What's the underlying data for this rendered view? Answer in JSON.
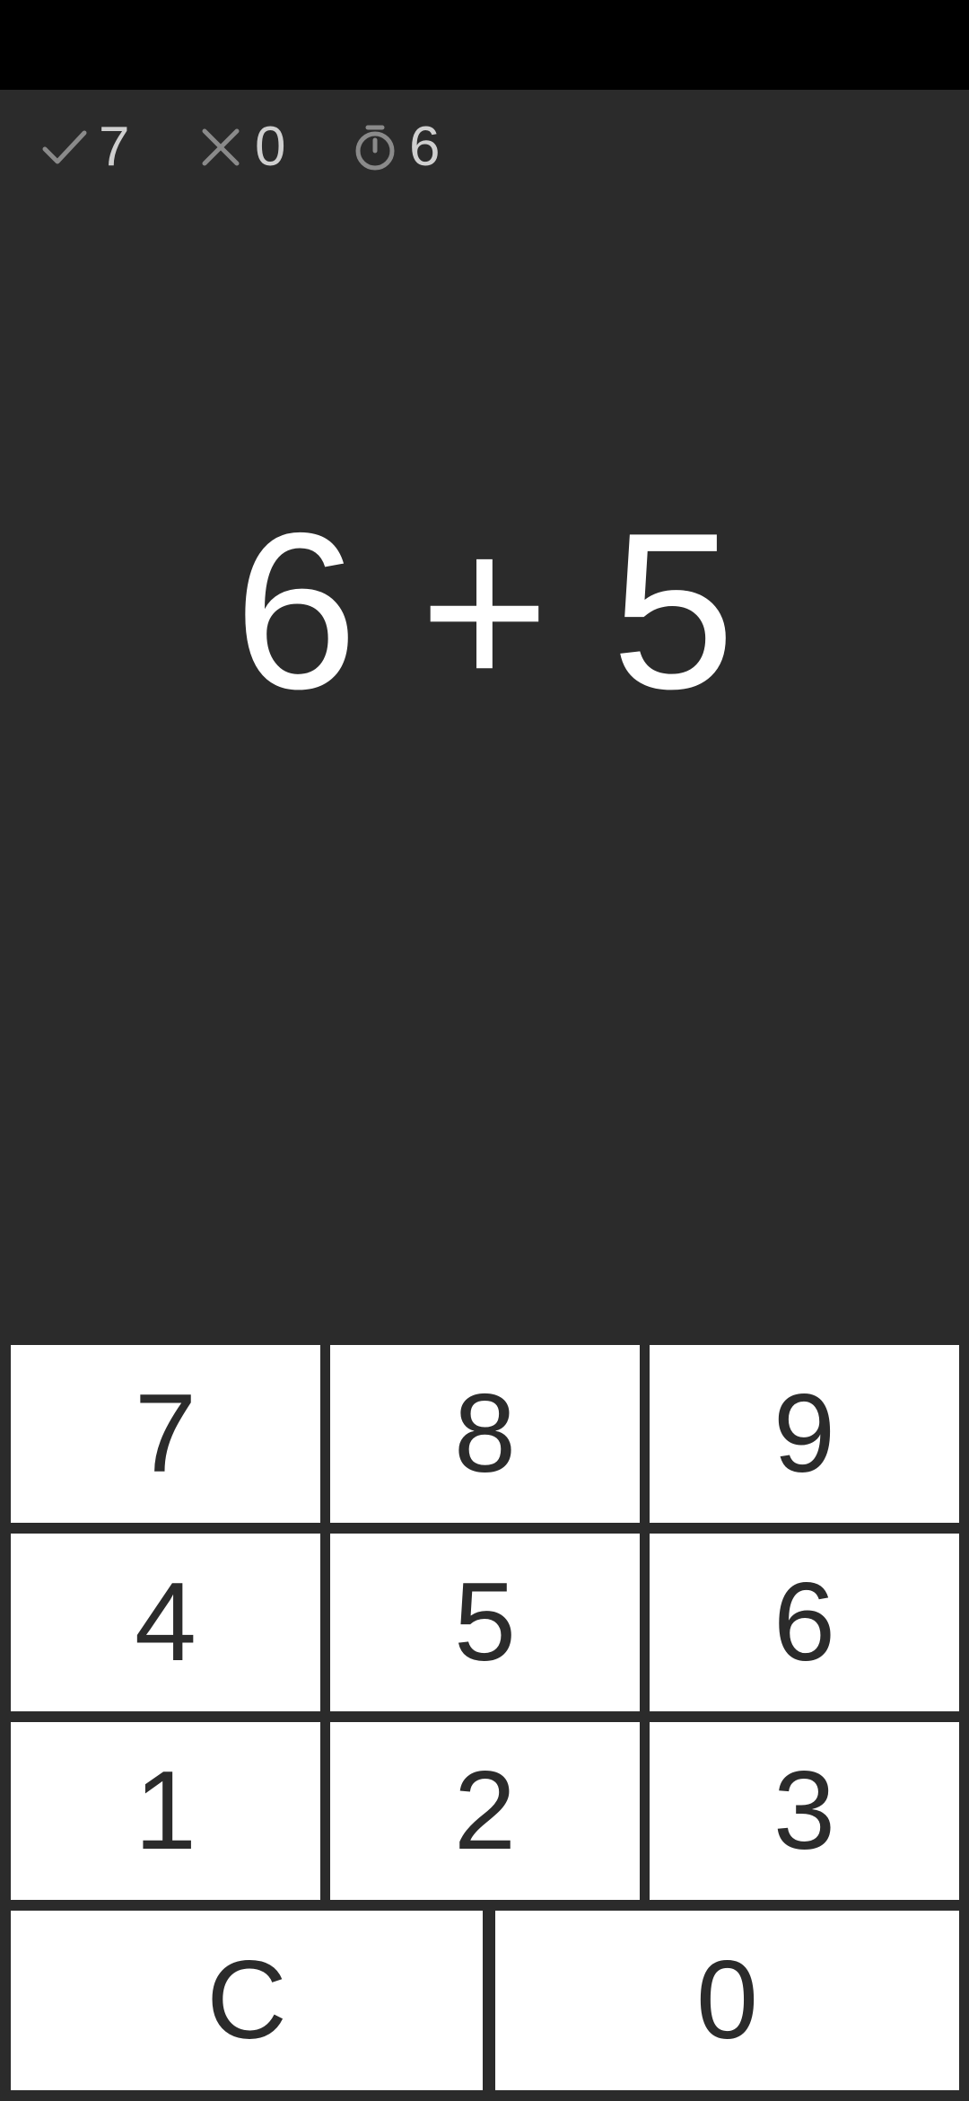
{
  "stats": {
    "correct": "7",
    "wrong": "0",
    "timer": "6",
    "correct_icon": "check-icon",
    "wrong_icon": "x-icon",
    "timer_icon": "stopwatch-icon"
  },
  "problem": {
    "text": "6 + 5"
  },
  "keypad": {
    "keys": [
      "7",
      "8",
      "9",
      "4",
      "5",
      "6",
      "1",
      "2",
      "3"
    ],
    "clear": "C",
    "zero": "0"
  },
  "colors": {
    "background": "#2b2b2b",
    "key_background": "#ffffff",
    "key_text": "#2b2b2b",
    "stat_icon": "#8a8a8a",
    "stat_text": "#cfcfcf"
  }
}
